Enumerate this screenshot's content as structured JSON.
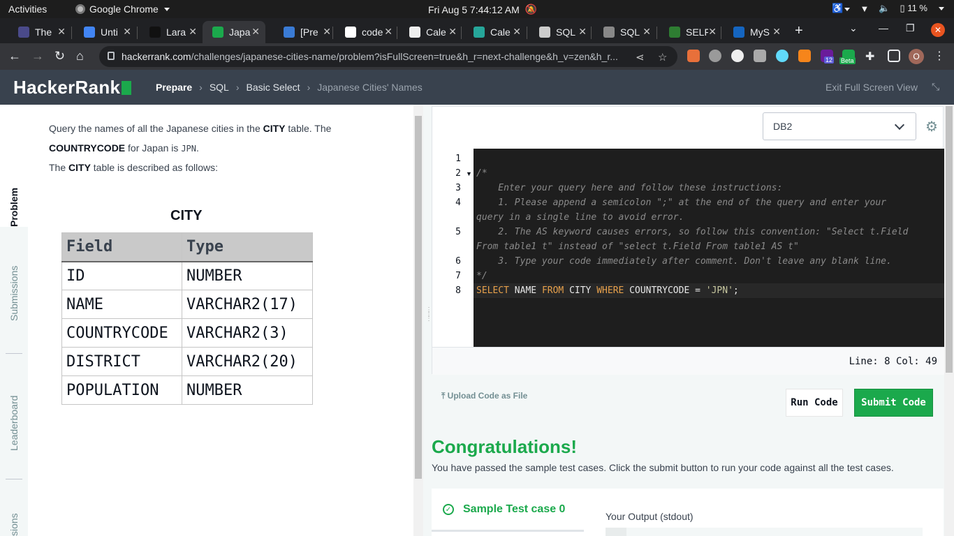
{
  "os_bar": {
    "activities": "Activities",
    "app_name": "Google Chrome",
    "clock": "Fri Aug 5  7:44:12 AM",
    "battery": "11 %"
  },
  "browser": {
    "tabs": [
      {
        "title": "The",
        "color": "#4a4a8a"
      },
      {
        "title": "Unti",
        "color": "#4285f4"
      },
      {
        "title": "Lara",
        "color": "#111111"
      },
      {
        "title": "Japa",
        "color": "#1ba94c",
        "active": true
      },
      {
        "title": "[Pre",
        "color": "#3a7bd5"
      },
      {
        "title": "code",
        "color": "#ffffff"
      },
      {
        "title": "Cale",
        "color": "#eeeeee"
      },
      {
        "title": "Cale",
        "color": "#26a69a"
      },
      {
        "title": "SQL",
        "color": "#cccccc"
      },
      {
        "title": "SQL",
        "color": "#888888"
      },
      {
        "title": "SELF",
        "color": "#2e7d32"
      },
      {
        "title": "MyS",
        "color": "#1565c0"
      }
    ],
    "url_host": "hackerrank.com",
    "url_path": "/challenges/japanese-cities-name/problem?isFullScreen=true&h_r=next-challenge&h_v=zen&h_r...",
    "extension_badge": "12",
    "extension_beta": "Beta",
    "profile_initial": "O"
  },
  "header": {
    "logo": "HackerRank",
    "breadcrumbs": [
      "Prepare",
      "SQL",
      "Basic Select",
      "Japanese Cities' Names"
    ],
    "exit_full_screen": "Exit Full Screen View"
  },
  "left_rail": {
    "tabs": [
      "Problem",
      "Submissions",
      "Leaderboard",
      "sions"
    ]
  },
  "problem": {
    "line1_a": "Query the names of all the Japanese cities in the ",
    "line1_b": "CITY",
    "line1_c": " table. The",
    "line2_a": "COUNTRYCODE",
    "line2_b": " for Japan is ",
    "line2_c": "JPN",
    "line2_d": ".",
    "line3_a": "The ",
    "line3_b": "CITY",
    "line3_c": " table is described as follows:",
    "table_title": "CITY",
    "table_headers": [
      "Field",
      "Type"
    ],
    "table_rows": [
      [
        "ID",
        "NUMBER"
      ],
      [
        "NAME",
        "VARCHAR2(17)"
      ],
      [
        "COUNTRYCODE",
        "VARCHAR2(3)"
      ],
      [
        "DISTRICT",
        "VARCHAR2(20)"
      ],
      [
        "POPULATION",
        "NUMBER"
      ]
    ]
  },
  "editor": {
    "language": "DB2",
    "line_numbers": [
      "1",
      "2",
      "3",
      "4",
      "5",
      "6",
      "7",
      "8"
    ],
    "code_lines": [
      "/*",
      "    Enter your query here and follow these instructions:",
      "    1. Please append a semicolon \";\" at the end of the query and enter your",
      "query in a single line to avoid error.",
      "    2. The AS keyword causes errors, so follow this convention: \"Select t.Field",
      "From table1 t\" instead of \"select t.Field From table1 AS t\"",
      "    3. Type your code immediately after comment. Don't leave any blank line.",
      "*/"
    ],
    "query": {
      "k1": "SELECT",
      "t1": " NAME ",
      "k2": "FROM",
      "t2": " CITY ",
      "k3": "WHERE",
      "t3": " COUNTRYCODE = ",
      "s1": "'JPN'",
      "t4": ";"
    },
    "status": "Line: 8 Col: 49"
  },
  "actions": {
    "upload": "Upload Code as File",
    "run": "Run Code",
    "submit": "Submit Code"
  },
  "result": {
    "title": "Congratulations!",
    "message": "You have passed the sample test cases. Click the submit button to run your code against all the test cases.",
    "test_case": "Sample Test case 0",
    "output_label": "Your Output (stdout)"
  }
}
